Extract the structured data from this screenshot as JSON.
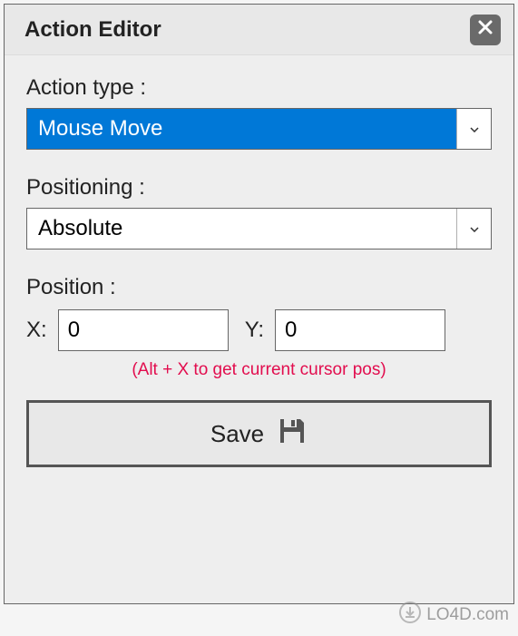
{
  "titlebar": {
    "title": "Action Editor"
  },
  "actionType": {
    "label": "Action type :",
    "value": "Mouse Move"
  },
  "positioning": {
    "label": "Positioning :",
    "value": "Absolute"
  },
  "position": {
    "label": "Position :",
    "xLabel": "X:",
    "xValue": "0",
    "yLabel": "Y:",
    "yValue": "0",
    "hint": "(Alt + X to get current cursor pos)"
  },
  "save": {
    "label": "Save"
  },
  "watermark": {
    "text": "LO4D.com"
  }
}
